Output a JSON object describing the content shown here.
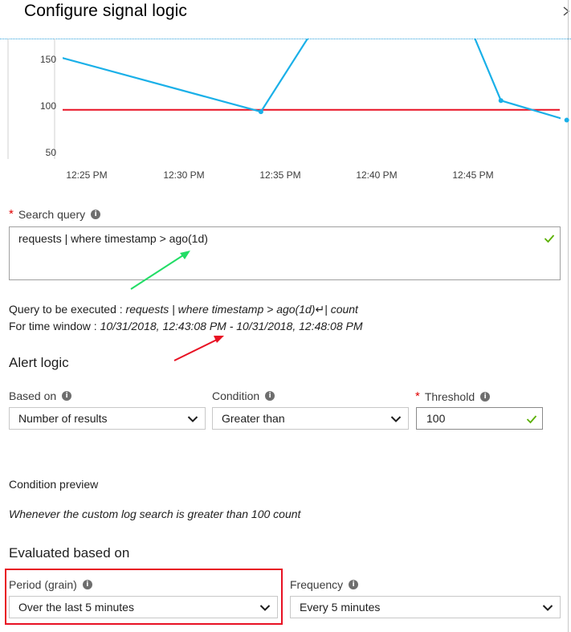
{
  "header": {
    "title": "Configure signal logic",
    "close_icon": "chevron-right-icon"
  },
  "chart_data": {
    "type": "line",
    "x_tick_labels": [
      "12:25 PM",
      "12:30 PM",
      "12:35 PM",
      "12:40 PM",
      "12:45 PM"
    ],
    "y_tick_labels": [
      "150",
      "100",
      "50"
    ],
    "ylim": [
      35,
      185
    ],
    "series": [
      {
        "color": "#1ab0e8",
        "points": [
          {
            "t": 12.33,
            "y": 215
          },
          {
            "t": 34.0,
            "y": 93
          },
          {
            "t": 37.9,
            "y": 220
          },
          {
            "t": 44.2,
            "y": 214
          },
          {
            "t": 46.4,
            "y": 105
          },
          {
            "t": 49.8,
            "y": 84
          }
        ]
      }
    ],
    "threshold": {
      "value": 95,
      "color": "#e81123"
    },
    "grid": false
  },
  "search_query": {
    "label": "Search query",
    "required_mark": "*",
    "value": "requests | where timestamp > ago(1d)"
  },
  "execution": {
    "query_prefix": "Query to be executed :",
    "query_value": "requests | where timestamp > ago(1d)↵| count",
    "window_prefix": "For time window :",
    "window_value": "10/31/2018, 12:43:08 PM - 10/31/2018, 12:48:08 PM"
  },
  "alert_logic": {
    "heading": "Alert logic",
    "based_on_label": "Based on",
    "based_on_value": "Number of results",
    "condition_label": "Condition",
    "condition_value": "Greater than",
    "threshold_label": "Threshold",
    "threshold_required_mark": "*",
    "threshold_value": "100"
  },
  "preview": {
    "label": "Condition preview",
    "text": "Whenever the custom log search is greater than 100 count"
  },
  "evaluated": {
    "heading": "Evaluated based on",
    "period_label": "Period (grain)",
    "period_value": "Over the last 5 minutes",
    "frequency_label": "Frequency",
    "frequency_value": "Every 5 minutes"
  },
  "colors": {
    "accent_line": "#1ab0e8",
    "threshold": "#e81123",
    "valid_check": "#5ab000",
    "highlight_box": "#e81123",
    "arrow_green": "#22dd66",
    "arrow_red": "#e81123"
  }
}
